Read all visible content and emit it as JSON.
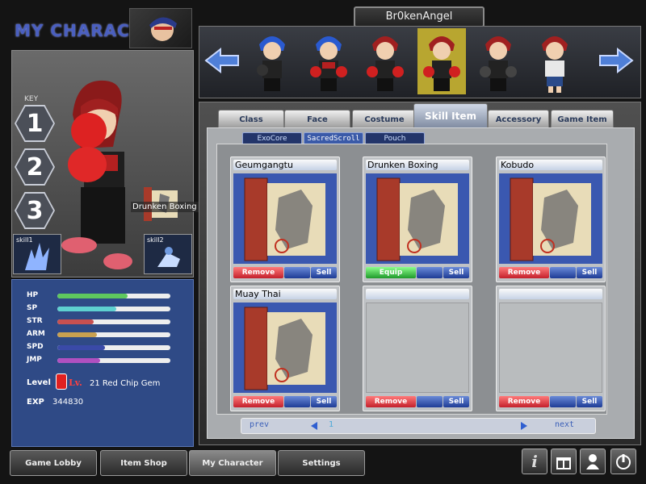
{
  "header": {
    "title": "MY CHARACTER",
    "player_name": "Br0kenAngel"
  },
  "key_panel": {
    "label": "KEY",
    "keys": [
      "1",
      "2",
      "3"
    ]
  },
  "skills": {
    "skill1_label": "skill1",
    "skill2_label": "skill2",
    "tooltip": "Drunken Boxing"
  },
  "stats": {
    "items": [
      {
        "label": "HP",
        "value": 0.62,
        "color": "#5ec85e"
      },
      {
        "label": "SP",
        "value": 0.52,
        "color": "#5ed0d0"
      },
      {
        "label": "STR",
        "value": 0.32,
        "color": "#c85050"
      },
      {
        "label": "ARM",
        "value": 0.35,
        "color": "#c8a050"
      },
      {
        "label": "SPD",
        "value": 0.42,
        "color": "#3a4aa8"
      },
      {
        "label": "JMP",
        "value": 0.38,
        "color": "#b050c0"
      }
    ],
    "level_label": "Level",
    "level_lv": "Lv.",
    "level_text": "21 Red Chip Gem",
    "exp_label": "EXP",
    "exp_value": "344830"
  },
  "tabs": [
    "Class",
    "Face",
    "Costume",
    "Skill Item",
    "Accessory",
    "Game Item"
  ],
  "active_tab": "Skill Item",
  "subtabs": [
    "ExoCore",
    "SacredScroll",
    "Pouch"
  ],
  "active_subtab": "SacredScroll",
  "items": [
    {
      "name": "Geumgangtu",
      "action": "Remove",
      "sell": "Sell"
    },
    {
      "name": "Drunken Boxing",
      "action": "Equip",
      "sell": "Sell"
    },
    {
      "name": "Kobudo",
      "action": "Remove",
      "sell": "Sell"
    },
    {
      "name": "Muay Thai",
      "action": "Remove",
      "sell": "Sell"
    },
    {
      "name": "",
      "action": "Remove",
      "sell": "Sell"
    },
    {
      "name": "",
      "action": "Remove",
      "sell": "Sell"
    }
  ],
  "pager": {
    "prev": "prev",
    "next": "next",
    "page": "1"
  },
  "nav": [
    "Game Lobby",
    "Item Shop",
    "My Character",
    "Settings"
  ],
  "active_nav": "My Character",
  "system_icons": [
    "info-icon",
    "gift-icon",
    "profile-icon",
    "power-icon"
  ],
  "colors": {
    "accent_blue": "#3a58b0",
    "remove_red": "#c4202c",
    "equip_green": "#1f9a2a"
  }
}
